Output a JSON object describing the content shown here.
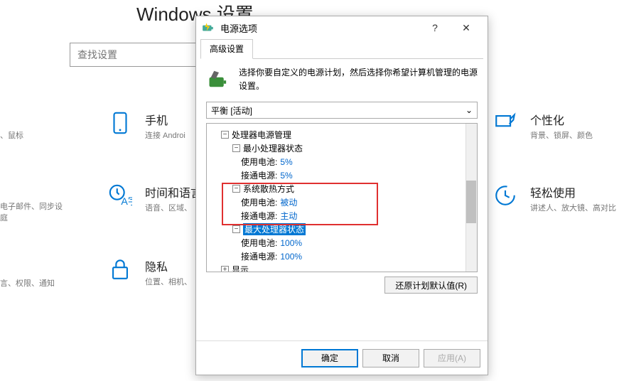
{
  "settings": {
    "title": "Windows 设置",
    "search_placeholder": "查找设置",
    "groups": {
      "phone": {
        "title": "手机",
        "desc": "连接 Androi"
      },
      "timelang": {
        "title": "时间和语言",
        "desc": "语音、区域、"
      },
      "privacy": {
        "title": "隐私",
        "desc": "位置、相机、"
      },
      "personalize": {
        "title": "个性化",
        "desc": "背景、锁屏、颜色"
      },
      "ease": {
        "title": "轻松使用",
        "desc": "讲述人、放大镜、高对比"
      }
    },
    "left_hints": {
      "a": "、鼠标",
      "b": "电子邮件、同步设\n庭",
      "c": "言、权限、通知"
    }
  },
  "dialog": {
    "title": "电源选项",
    "tab": "高级设置",
    "hint": "选择你要自定义的电源计划，然后选择你希望计算机管理的电源设置。",
    "plan": "平衡 [活动]",
    "restore": "还原计划默认值(R)",
    "ok": "确定",
    "cancel": "取消",
    "apply": "应用(A)",
    "tree": {
      "cpu": "处理器电源管理",
      "min": "最小处理器状态",
      "battery_label": "使用电池:",
      "plugged_label": "接通电源:",
      "min_battery": "5%",
      "min_plugged": "5%",
      "cooling": "系统散热方式",
      "cool_battery": "被动",
      "cool_plugged": "主动",
      "max": "最大处理器状态",
      "max_battery": "100%",
      "max_plugged": "100%",
      "display": "显示"
    }
  }
}
